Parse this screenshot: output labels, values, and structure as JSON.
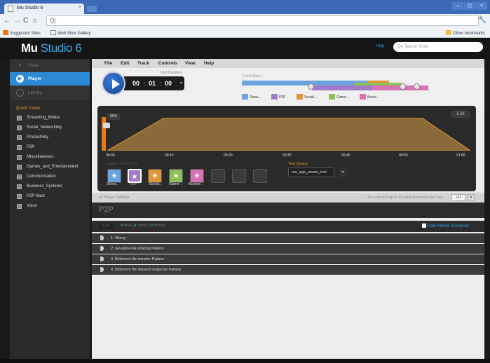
{
  "browser": {
    "tab_title": "Mu Studio 6",
    "tab_close": "×",
    "url": "Q|",
    "window_controls": [
      "–",
      "◻",
      "×"
    ],
    "bookmarks": [
      "Suggested Sites",
      "Web Slice Gallery"
    ],
    "other_bookmarks": "Other bookmarks"
  },
  "header": {
    "logo_bold": "Mu",
    "logo_rest": "Studio 6",
    "help": "Help",
    "search_placeholder": "Q▾ Search Store"
  },
  "sidebar": {
    "store": "Store",
    "player": "Player",
    "library": "Library",
    "quick_tracks_label": "Quick Tracks",
    "quick_tracks": [
      "Streaming_Media",
      "Social_Networking",
      "Productivity",
      "P2P",
      "Miscellaneous",
      "Games_and_Entertainment",
      "Communication",
      "Business_Systems",
      "P2P track",
      "Voice"
    ]
  },
  "menu": [
    "File",
    "Edit",
    "Track",
    "Controls",
    "View",
    "Help"
  ],
  "player": {
    "duration_label": "Test Duration",
    "hours": "00",
    "minutes": "01",
    "seconds": "00",
    "track_mixer_label": "Track Mixer",
    "mixer_tracks": [
      {
        "label": "Strea...",
        "color": "#6aa3dd"
      },
      {
        "label": "P2P",
        "color": "#a07bc8"
      },
      {
        "label": "Social...",
        "color": "#e5943a"
      },
      {
        "label": "Game...",
        "color": "#8fbf56"
      },
      {
        "label": "Busin...",
        "color": "#d872b6"
      }
    ],
    "edit_button": "Edit",
    "volume_percent": "80%",
    "volume_level": 0.8,
    "time_ticks": [
      "00:00",
      "00:10",
      "00:20",
      "00:30",
      "00:40",
      "00:50",
      "01:00"
    ],
    "loaded_tracks_label": "Loaded Tracks (5)",
    "loaded_tracks": [
      {
        "label": "Strea...",
        "color": "#6aa3dd"
      },
      {
        "label": "P2P",
        "color": "#a07bc8"
      },
      {
        "label": "Social...",
        "color": "#e5943a"
      },
      {
        "label": "Game...",
        "color": "#8fbf56"
      },
      {
        "label": "Busine...",
        "color": "#d872b6"
      }
    ],
    "test_queue_label": "Test Queue",
    "test_queue_value": "mu_app_aware_test"
  },
  "settings": {
    "label": "Player Settings",
    "note": "You can run up to 50 total scenarios per test",
    "page_value": "+31"
  },
  "section": {
    "title": "P2P",
    "filter_all": "All",
    "count_all": "4",
    "label_all": "total",
    "count_active": "4",
    "label_active": "active",
    "count_muted": "0",
    "label_muted": "muted",
    "hide_muted": "Hide Muted Scenarios",
    "scenarios": [
      "1. Winny",
      "2. Gnutella File sharing Pattern",
      "3. Bittorrent file transfer Pattern",
      "4. Bittorrent file request response Pattern"
    ]
  },
  "colors": {
    "accent": "#2b8ad6",
    "orange": "#e87a14"
  }
}
